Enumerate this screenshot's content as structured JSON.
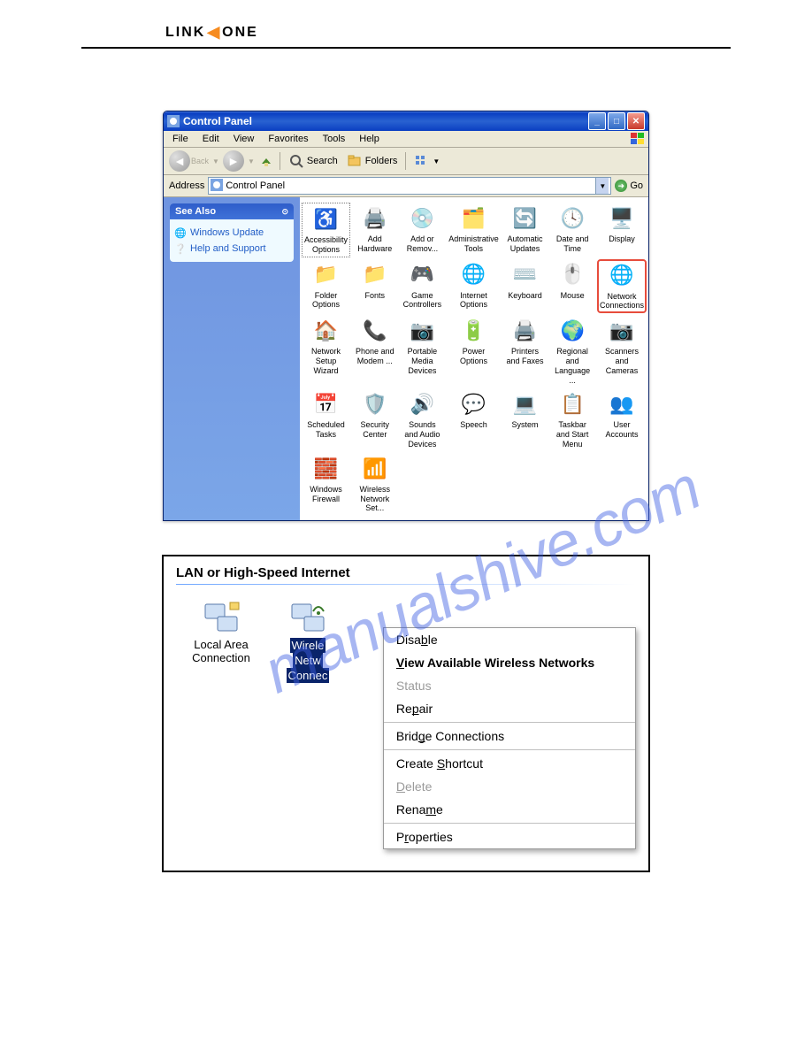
{
  "logo": {
    "part1": "LINK",
    "part2": "ONE"
  },
  "watermark": "manualshive.com",
  "window1": {
    "title": "Control Panel",
    "menus": [
      "File",
      "Edit",
      "View",
      "Favorites",
      "Tools",
      "Help"
    ],
    "toolbar": {
      "back": "Back",
      "search": "Search",
      "folders": "Folders"
    },
    "address": {
      "label": "Address",
      "value": "Control Panel",
      "go": "Go"
    },
    "sidepanel": {
      "title": "See Also",
      "links": [
        "Windows Update",
        "Help and Support"
      ]
    },
    "items": [
      {
        "label": "Accessibility Options",
        "icon": "♿",
        "box": true
      },
      {
        "label": "Add Hardware",
        "icon": "🖨️"
      },
      {
        "label": "Add or Remov...",
        "icon": "💿"
      },
      {
        "label": "Administrative Tools",
        "icon": "🗂️"
      },
      {
        "label": "Automatic Updates",
        "icon": "🔄"
      },
      {
        "label": "Date and Time",
        "icon": "🕓"
      },
      {
        "label": "Display",
        "icon": "🖥️"
      },
      {
        "label": "Folder Options",
        "icon": "📁"
      },
      {
        "label": "Fonts",
        "icon": "📁"
      },
      {
        "label": "Game Controllers",
        "icon": "🎮"
      },
      {
        "label": "Internet Options",
        "icon": "🌐"
      },
      {
        "label": "Keyboard",
        "icon": "⌨️"
      },
      {
        "label": "Mouse",
        "icon": "🖱️"
      },
      {
        "label": "Network Connections",
        "icon": "🌐",
        "highlight": true
      },
      {
        "label": "Network Setup Wizard",
        "icon": "🏠"
      },
      {
        "label": "Phone and Modem ...",
        "icon": "📞"
      },
      {
        "label": "Portable Media Devices",
        "icon": "📷"
      },
      {
        "label": "Power Options",
        "icon": "🔋"
      },
      {
        "label": "Printers and Faxes",
        "icon": "🖨️"
      },
      {
        "label": "Regional and Language ...",
        "icon": "🌍"
      },
      {
        "label": "Scanners and Cameras",
        "icon": "📷"
      },
      {
        "label": "Scheduled Tasks",
        "icon": "📅"
      },
      {
        "label": "Security Center",
        "icon": "🛡️"
      },
      {
        "label": "Sounds and Audio Devices",
        "icon": "🔊"
      },
      {
        "label": "Speech",
        "icon": "💬"
      },
      {
        "label": "System",
        "icon": "💻"
      },
      {
        "label": "Taskbar and Start Menu",
        "icon": "📋"
      },
      {
        "label": "User Accounts",
        "icon": "👥"
      },
      {
        "label": "Windows Firewall",
        "icon": "🧱"
      },
      {
        "label": "Wireless Network Set...",
        "icon": "📶"
      }
    ]
  },
  "window2": {
    "section_title": "LAN or High-Speed Internet",
    "connections": [
      {
        "label_lines": [
          "Local Area",
          "Connection"
        ],
        "icon": "🖥️",
        "selected": false
      },
      {
        "label_lines": [
          "Wirele",
          "Netw",
          "Connec"
        ],
        "icon": "📶",
        "selected": true
      }
    ],
    "context_menu": [
      {
        "label": "Disable",
        "type": "item",
        "u": 4
      },
      {
        "label": "View Available Wireless Networks",
        "type": "bold",
        "u": 0
      },
      {
        "label": "Status",
        "type": "disabled"
      },
      {
        "label": "Repair",
        "type": "item",
        "u": 2
      },
      {
        "label": "",
        "type": "sep"
      },
      {
        "label": "Bridge Connections",
        "type": "item",
        "u": 4
      },
      {
        "label": "",
        "type": "sep"
      },
      {
        "label": "Create Shortcut",
        "type": "item",
        "u": 7
      },
      {
        "label": "Delete",
        "type": "disabled",
        "u": 0
      },
      {
        "label": "Rename",
        "type": "item",
        "u": 4
      },
      {
        "label": "",
        "type": "sep"
      },
      {
        "label": "Properties",
        "type": "item",
        "u": 1
      }
    ]
  }
}
